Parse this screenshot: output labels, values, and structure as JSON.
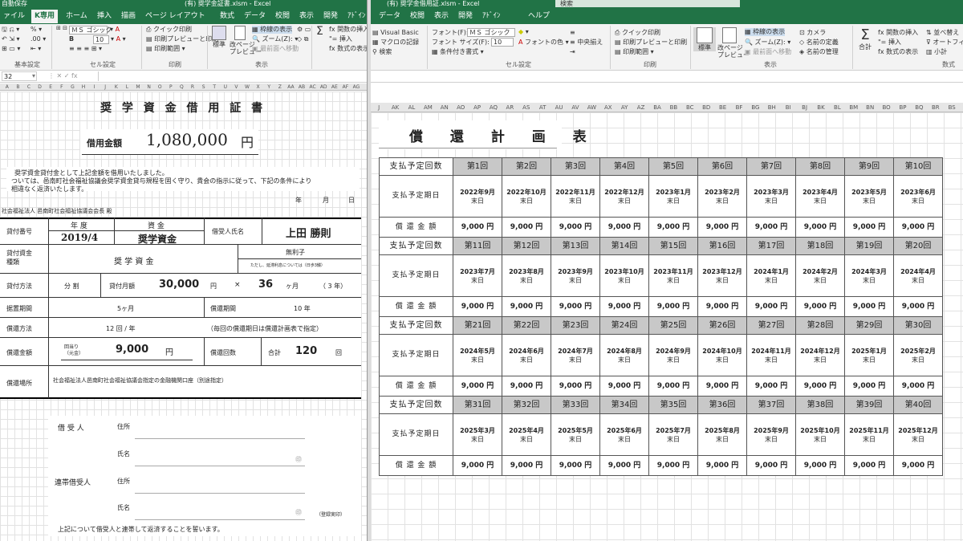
{
  "left": {
    "titlebar": {
      "autosave": "自動保存",
      "file": "(有)  奨学金証書.xlsm  -  Excel"
    },
    "tabs": [
      "ァイル",
      "K専用",
      "ホーム",
      "挿入",
      "描画",
      "ページ レイアウト",
      "数式",
      "データ",
      "校閲",
      "表示",
      "開発",
      "ｱﾄﾞｲﾝ",
      "ヘルプ"
    ],
    "ribbon": {
      "font_name": "ＭＳ ゴシック",
      "font_size": "10",
      "quick_print": "クイック印刷",
      "print_preview": "印刷プレビューと印刷",
      "print_area": "印刷範囲",
      "standard": "標準",
      "page_break": "改ページ\nプレビュー",
      "gridlines": "枠線の表示",
      "zoom": "ズーム(Z):",
      "last_cell": "最前面へ移動",
      "groups": [
        "基本設定",
        "セル設定",
        "印刷",
        "表示"
      ]
    },
    "namebox": "32",
    "col_letters": [
      "A",
      "B",
      "C",
      "D",
      "E",
      "F",
      "G",
      "H",
      "I",
      "J",
      "K",
      "L",
      "M",
      "N",
      "O",
      "P",
      "Q",
      "R",
      "S",
      "T",
      "U",
      "V",
      "W",
      "X",
      "Y",
      "Z",
      "AA",
      "AB",
      "AC",
      "AD",
      "AE",
      "AF",
      "AG"
    ],
    "doc": {
      "title": "奨 学 資 金 借 用 証 書",
      "amount_label": "借用金額",
      "amount_value": "1,080,000",
      "amount_unit": "円",
      "intro_1": "奨学資金貸付金として上記金額を借用いたしました。",
      "intro_2": "ついては、邑南町社会福祉協議会奨学資金貸与規程を固く守り、貴会の指示に従って、下記の条件により",
      "intro_3": "相違なく返済いたします。",
      "date_year": "年",
      "date_month": "月",
      "date_day": "日",
      "addressee": "社会福祉法人  邑南町社会福祉協議会会長  殿",
      "loan_no_label": "貸付番号",
      "year_label": "年 度",
      "year_value": "2019/4",
      "fund_label": "資 金",
      "fund_value": "奨学資金",
      "borrower_label": "借受人氏名",
      "borrower_name": "上田  勝則",
      "fund_type_label": "貸付資金\n種類",
      "fund_type_value": "奨 学 資 金",
      "interest": "無利子",
      "interest_note": "ただし、延滞利息については（日歩3銭）",
      "method_label": "貸付方法",
      "method_value": "分 割",
      "monthly_label": "貸付月額",
      "monthly_value": "30,000",
      "yen": "円",
      "times": "×",
      "months_value": "36",
      "months_unit": "ヶ月",
      "years_note": "（ 3 年）",
      "grace_label": "据置期間",
      "grace_value": "5ヶ月",
      "repay_period_label": "償還期間",
      "repay_period_value": "10  年",
      "repay_method_label": "償還方法",
      "repay_method_value": "12  回 / 年",
      "repay_method_note": "（毎回の償還期日は償還計画表で指定）",
      "repay_amount_label": "償還金額",
      "per_time_label": "回当り\n（元金）",
      "per_time_value": "9,000",
      "repay_count_label": "償還回数",
      "total_label": "合計",
      "total_value": "120",
      "kai": "回",
      "place_label": "償還場所",
      "place_value": "社会福祉法人邑南町社会福祉協議会指定の金融機関口座（別途指定）",
      "borrower_sig": "借  受  人",
      "guarantor_sig": "連帯借受人",
      "address_label": "住所",
      "name_label": "氏名",
      "seal": "㊞",
      "registered_seal": "（登録実印）",
      "footer": "上記について借受人と連帯して返済することを誓います。"
    }
  },
  "right": {
    "titlebar": {
      "file": "(有)  奨学金借用証.xlsm  -  Excel",
      "search": "検索"
    },
    "tabs": [
      "データ",
      "校閲",
      "表示",
      "開発",
      "ｱﾄﾞｲﾝ",
      "ヘルプ"
    ],
    "ribbon": {
      "visual_basic": "Visual Basic",
      "macro_record": "マクロの記録",
      "search": "検索",
      "font_label": "フォント(F):",
      "font_value": "ＭＳ ゴシック",
      "size_label": "フォント サイズ(F):",
      "size_value": "10",
      "font_color": "フォントの色",
      "center": "中央揃え",
      "cond_format": "条件付き書式",
      "quick_print": "クイック印刷",
      "print_preview": "印刷プレビューと印刷",
      "print_area": "印刷範囲",
      "standard": "標準",
      "page_break": "改ページ\nプレビュー",
      "gridlines": "枠線の表示",
      "zoom": "ズーム(Z):",
      "front": "最前面へ移動",
      "camera": "カメラ",
      "define_name": "名前の定義",
      "name_manager": "名前の管理",
      "sum": "合計",
      "insert_func": "関数の挿入",
      "insert": "挿入",
      "show_formula": "数式の表示",
      "sort": "並べ替え",
      "autofilter": "オートフィル",
      "subtotal": "小計",
      "groups": [
        "セル設定",
        "印刷",
        "表示",
        "数式"
      ]
    },
    "col_letters": [
      "J",
      "AK",
      "AL",
      "AM",
      "AN",
      "AO",
      "AP",
      "AQ",
      "AR",
      "AS",
      "AT",
      "AU",
      "AV",
      "AW",
      "AX",
      "AY",
      "AZ",
      "BA",
      "BB",
      "BC",
      "BD",
      "BE",
      "BF",
      "BG",
      "BH",
      "BI",
      "BJ",
      "BK",
      "BL",
      "BM",
      "BN",
      "BO",
      "BP",
      "BQ",
      "BR",
      "BS",
      "BT"
    ],
    "plan_title": "償 還 計 画 表",
    "row_labels": {
      "count": "支払予定回数",
      "date": "支払予定期日",
      "amount": "償 還 金 額"
    },
    "blocks": [
      {
        "nums": [
          "第1回",
          "第2回",
          "第3回",
          "第4回",
          "第5回",
          "第6回",
          "第7回",
          "第8回",
          "第9回",
          "第10回"
        ],
        "dates": [
          "2022年9月",
          "2022年10月",
          "2022年11月",
          "2022年12月",
          "2023年1月",
          "2023年2月",
          "2023年3月",
          "2023年4月",
          "2023年5月",
          "2023年6月"
        ]
      },
      {
        "nums": [
          "第11回",
          "第12回",
          "第13回",
          "第14回",
          "第15回",
          "第16回",
          "第17回",
          "第18回",
          "第19回",
          "第20回"
        ],
        "dates": [
          "2023年7月",
          "2023年8月",
          "2023年9月",
          "2023年10月",
          "2023年11月",
          "2023年12月",
          "2024年1月",
          "2024年2月",
          "2024年3月",
          "2024年4月"
        ]
      },
      {
        "nums": [
          "第21回",
          "第22回",
          "第23回",
          "第24回",
          "第25回",
          "第26回",
          "第27回",
          "第28回",
          "第29回",
          "第30回"
        ],
        "dates": [
          "2024年5月",
          "2024年6月",
          "2024年7月",
          "2024年8月",
          "2024年9月",
          "2024年10月",
          "2024年11月",
          "2024年12月",
          "2025年1月",
          "2025年2月"
        ]
      },
      {
        "nums": [
          "第31回",
          "第32回",
          "第33回",
          "第34回",
          "第35回",
          "第36回",
          "第37回",
          "第38回",
          "第39回",
          "第40回"
        ],
        "dates": [
          "2025年3月",
          "2025年4月",
          "2025年5月",
          "2025年6月",
          "2025年7月",
          "2025年8月",
          "2025年9月",
          "2025年10月",
          "2025年11月",
          "2025年12月"
        ]
      }
    ],
    "end_of_month": "末日",
    "amount_value": "9,000  円"
  }
}
